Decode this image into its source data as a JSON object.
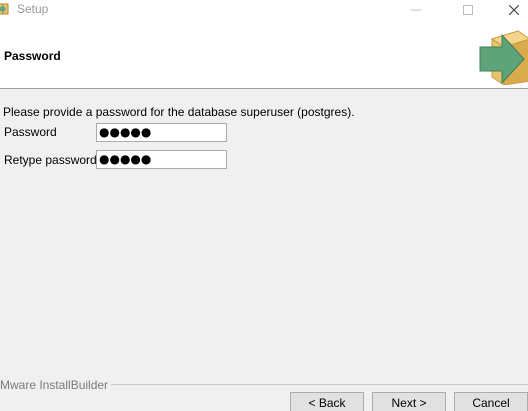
{
  "window": {
    "title": "Setup"
  },
  "header": {
    "title": "Password",
    "graphic_icon": "install-box-arrow-icon"
  },
  "content": {
    "instruction": "Please provide a password for the database superuser (postgres).",
    "password_label": "Password",
    "password_value": "●●●●●",
    "retype_label": "Retype password",
    "retype_value": "●●●●●"
  },
  "footer": {
    "brand": "Mware InstallBuilder",
    "back_label": "< Back",
    "next_label": "Next >",
    "cancel_label": "Cancel"
  },
  "colors": {
    "arrow": "#5ea37a",
    "box": "#e8c46a",
    "window_bg": "#f0f0f0"
  }
}
